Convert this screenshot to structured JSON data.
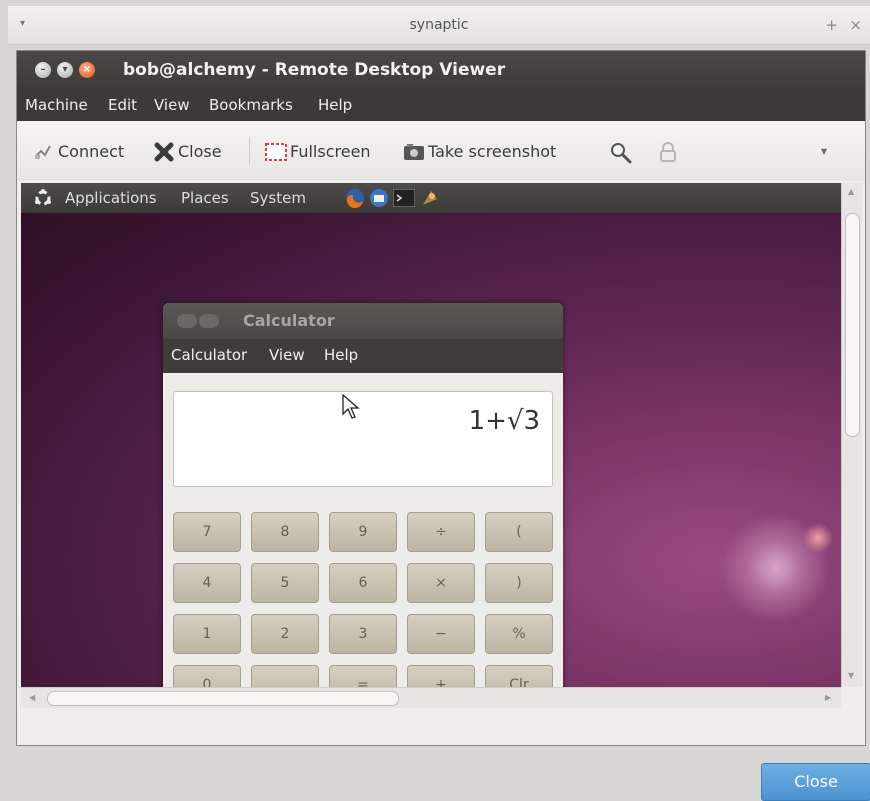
{
  "outer_window": {
    "title": "synaptic",
    "plus": "+",
    "close": "×",
    "menu_arrow": "▾"
  },
  "rdv": {
    "title": "bob@alchemy - Remote Desktop Viewer",
    "menu": [
      "Machine",
      "Edit",
      "View",
      "Bookmarks",
      "Help"
    ],
    "toolbar": {
      "connect": "Connect",
      "close": "Close",
      "fullscreen": "Fullscreen",
      "take_screenshot": "Take screenshot",
      "overflow": "▾"
    }
  },
  "remote_panel": {
    "applications": "Applications",
    "places": "Places",
    "system": "System"
  },
  "calculator": {
    "title": "Calculator",
    "menu": [
      "Calculator",
      "View",
      "Help"
    ],
    "display": "1+√3",
    "keys": [
      [
        "7",
        "8",
        "9",
        "÷",
        "("
      ],
      [
        "4",
        "5",
        "6",
        "×",
        ")"
      ],
      [
        "1",
        "2",
        "3",
        "−",
        "%"
      ],
      [
        "0",
        "",
        "=",
        "+",
        "Clr"
      ]
    ]
  },
  "dialog": {
    "close_button": "Close"
  },
  "colors": {
    "accent": "#4a92cf",
    "titlebar": "#3d3b37",
    "desktop": "#5a2450"
  },
  "icons": {
    "connect": "connect-icon",
    "close": "close-x-icon",
    "fullscreen": "fullscreen-icon",
    "screenshot": "camera-icon",
    "zoom": "magnifier-icon",
    "lock": "lock-icon"
  }
}
